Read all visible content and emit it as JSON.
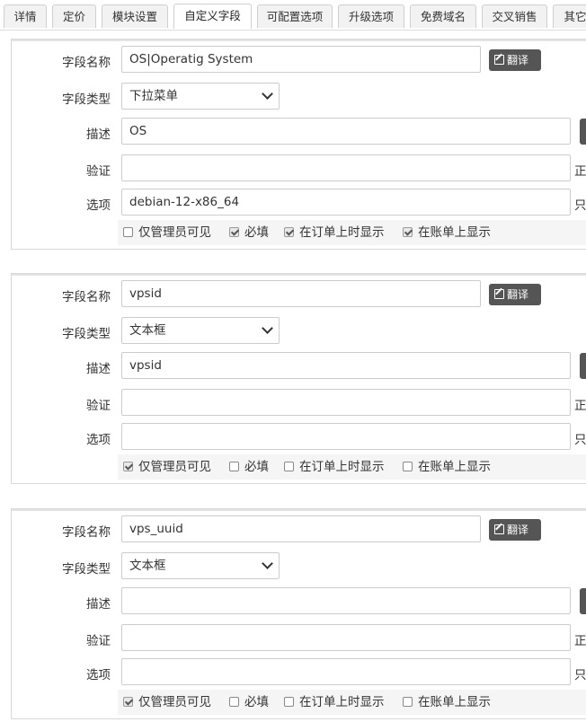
{
  "tabs": [
    {
      "label": "详情"
    },
    {
      "label": "定价"
    },
    {
      "label": "模块设置"
    },
    {
      "label": "自定义字段",
      "active": true
    },
    {
      "label": "可配置选项"
    },
    {
      "label": "升级选项"
    },
    {
      "label": "免费域名"
    },
    {
      "label": "交叉销售"
    },
    {
      "label": "其它"
    }
  ],
  "labels": {
    "field_name": "字段名称",
    "field_type": "字段类型",
    "description": "描述",
    "validation": "验证",
    "options": "选项",
    "translate_button": "翻译",
    "validation_side": "正",
    "options_side": "只"
  },
  "checkbox_labels": {
    "admin_only": "仅管理员可见",
    "required": "必填",
    "show_on_order": "在订单上时显示",
    "show_on_invoice": "在账单上显示"
  },
  "fields": [
    {
      "name": "OS|Operatig System",
      "type": "下拉菜单",
      "description": "OS",
      "validation": "",
      "options": "debian-12-x86_64",
      "admin_only": false,
      "required": true,
      "show_on_order": true,
      "show_on_invoice": true
    },
    {
      "name": "vpsid",
      "type": "文本框",
      "description": "vpsid",
      "validation": "",
      "options": "",
      "admin_only": true,
      "required": false,
      "show_on_order": false,
      "show_on_invoice": false
    },
    {
      "name": "vps_uuid",
      "type": "文本框",
      "description": "",
      "validation": "",
      "options": "",
      "admin_only": true,
      "required": false,
      "show_on_order": false,
      "show_on_invoice": false
    }
  ],
  "colors": {
    "button_bg": "#555555",
    "tab_bg": "#f2f2f2",
    "options_row_bg": "#f5f5f5"
  }
}
